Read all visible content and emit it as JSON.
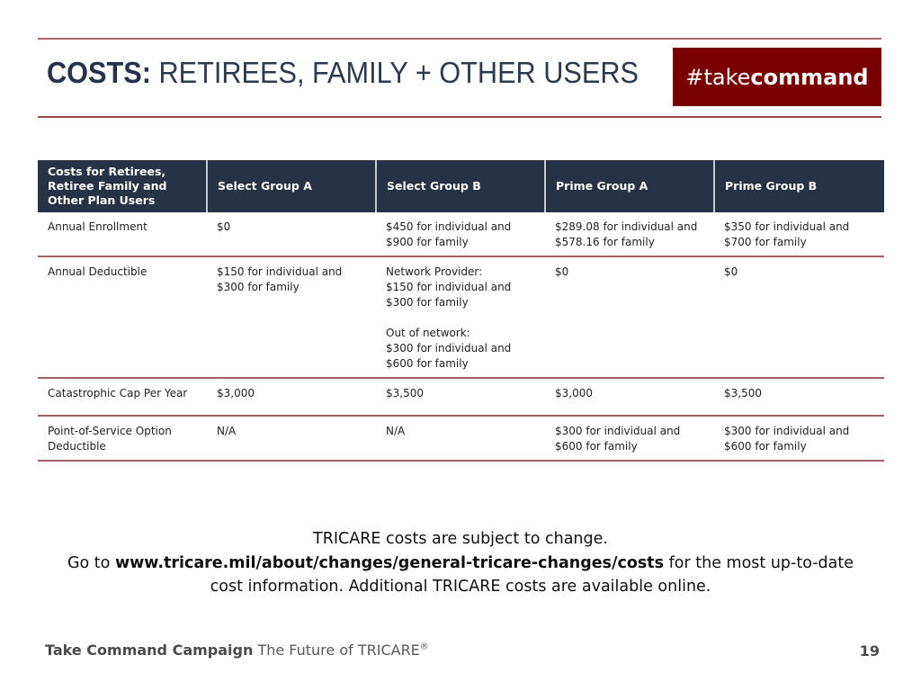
{
  "header": {
    "title_bold": "COSTS:",
    "title_rest": " RETIREES, FAMILY + OTHER USERS",
    "badge_light": "#take",
    "badge_bold": "command",
    "badge_color": "#7a0000"
  },
  "table": {
    "columns": [
      "Costs for Retirees, Retiree Family  and Other Plan Users",
      "Select Group  A",
      "Select Group  B",
      "Prime  Group  A",
      "Prime  Group  B"
    ],
    "rows": [
      {
        "label": "Annual  Enrollment",
        "cells": [
          "$0",
          "$450 for individual and\n$900 for family",
          "$289.08 for individual and\n$578.16 for family",
          "$350 for individual and\n$700 for family"
        ]
      },
      {
        "label": "Annual  Deductible",
        "cells": [
          "$150 for individual and\n$300 for family",
          {
            "network_provider": "Network Provider:\n$150 for individual and\n$300 for family",
            "out_of_network": "Out of network:\n$300 for individual and\n$600 for family"
          },
          "$0",
          "$0"
        ]
      },
      {
        "label": "Catastrophic Cap Per Year",
        "cells": [
          "$3,000",
          "$3,500",
          "$3,000",
          "$3,500"
        ]
      },
      {
        "label": "Point-of-Service Option\nDeductible",
        "cells": [
          "N/A",
          "N/A",
          "$300 for individual and\n$600 for family",
          "$300 for individual and\n$600 for family"
        ]
      }
    ]
  },
  "note": {
    "line1": "TRICARE costs are subject to change.",
    "line2_prefix": "Go to ",
    "link": "www.tricare.mil/about/changes/general-tricare-changes/costs",
    "line2_suffix": " for the most up-to-date",
    "line3": "cost information. Additional TRICARE costs are available online."
  },
  "footer": {
    "campaign_bold": "Take Command Campaign",
    "campaign_rest": " The Future of TRICARE",
    "registered": "®",
    "page_number": "19"
  }
}
